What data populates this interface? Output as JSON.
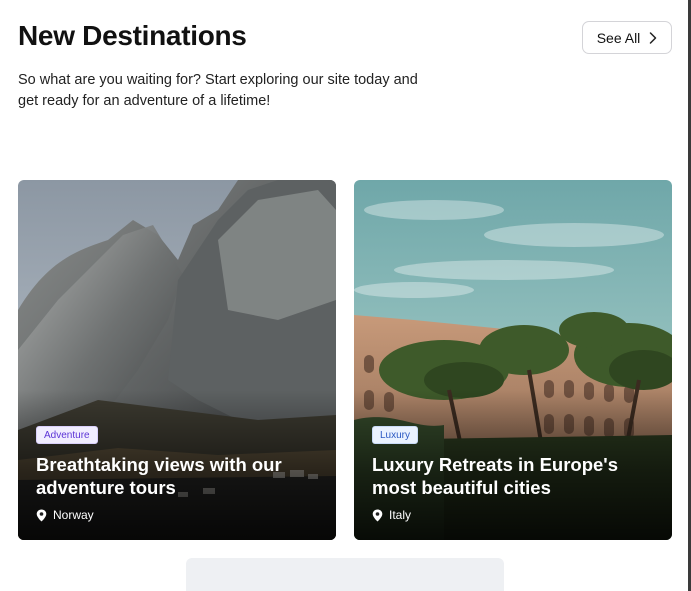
{
  "header": {
    "title": "New Destinations",
    "see_all_label": "See All",
    "subtitle": "So what are you waiting for? Start exploring our site today and get ready for an adventure of a lifetime!"
  },
  "cards": [
    {
      "tag": "Adventure",
      "title": "Breathtaking views with our adventure tours",
      "location": "Norway",
      "image": "mountain-photo",
      "tag_color": "#5b34d6"
    },
    {
      "tag": "Luxury",
      "title": "Luxury Retreats in Europe's most beautiful cities",
      "location": "Italy",
      "image": "colosseum-photo",
      "tag_color": "#2b59c3"
    }
  ],
  "icons": {
    "see_all": "chevron-right-icon",
    "location": "map-pin-icon"
  }
}
